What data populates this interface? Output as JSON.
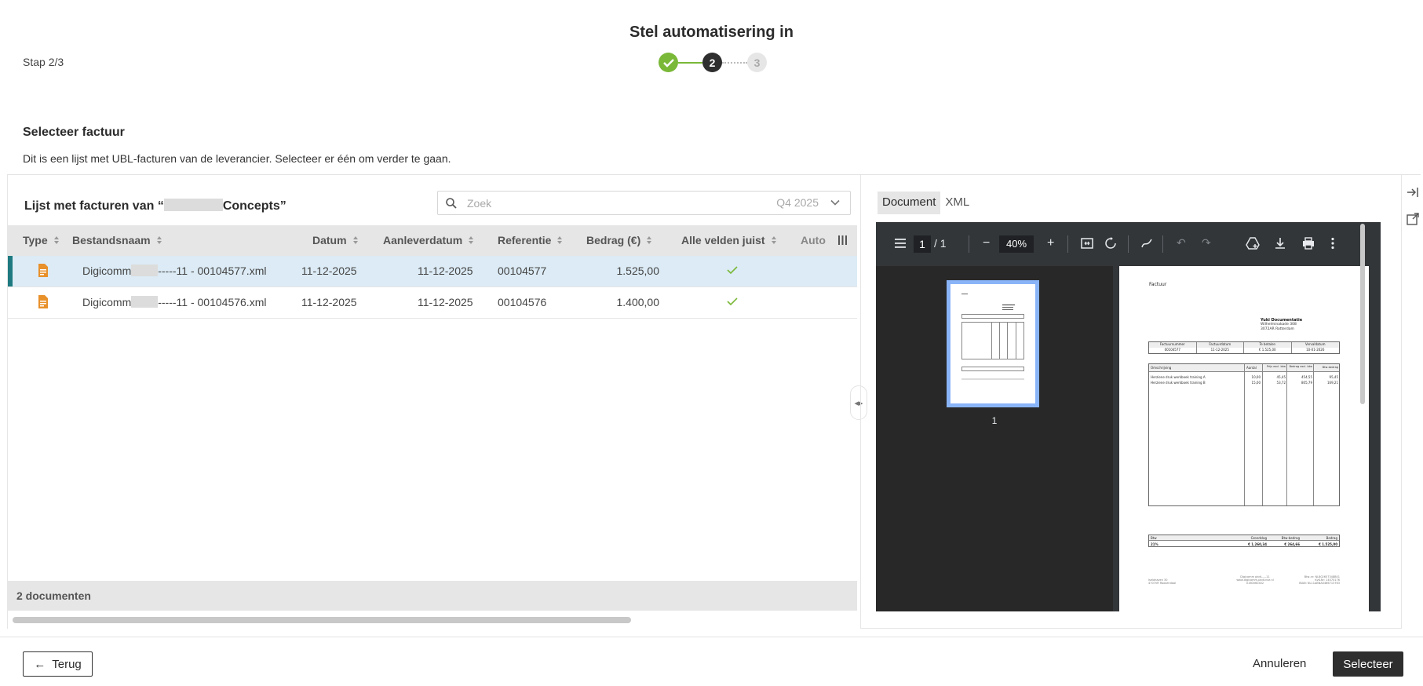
{
  "wizard": {
    "title": "Stel automatisering in",
    "step_label": "Stap 2/3",
    "steps": [
      "✓",
      "2",
      "3"
    ]
  },
  "section": {
    "title": "Selecteer factuur",
    "description": "Dit is een lijst met UBL-facturen van de leverancier. Selecteer er één om verder te gaan."
  },
  "list": {
    "title_prefix": "Lijst met facturen van “",
    "title_suffix": "Concepts”",
    "search_placeholder": "Zoek",
    "period": "Q4 2025",
    "columns": [
      "Type",
      "Bestandsnaam",
      "Datum",
      "Aanleverdatum",
      "Referentie",
      "Bedrag (€)",
      "Alle velden juist",
      "Auto"
    ],
    "rows": [
      {
        "name_prefix": "Digicomm",
        "name_suffix": "-----11 - 00104577.xml",
        "datum": "11-12-2025",
        "aanleverdatum": "11-12-2025",
        "referentie": "00104577",
        "bedrag": "1.525,00",
        "alle_velden_juist": true,
        "selected": true
      },
      {
        "name_prefix": "Digicomm",
        "name_suffix": "-----11 - 00104576.xml",
        "datum": "11-12-2025",
        "aanleverdatum": "11-12-2025",
        "referentie": "00104576",
        "bedrag": "1.400,00",
        "alle_velden_juist": true,
        "selected": false
      }
    ],
    "footer": "2 documenten"
  },
  "preview": {
    "tabs": [
      "Document",
      "XML"
    ],
    "active_tab": "Document",
    "pdf": {
      "page": "1",
      "page_total": "/  1",
      "zoom": "40%",
      "thumb_label": "1",
      "doc_heading": "Factuur",
      "company": "Yuki Documentatie",
      "address1": "Wilhelminakade 308",
      "address2": "3072AR  Rotterdam",
      "meta_headers": [
        "Factuurnummer",
        "Factuurdatum",
        "Te betalen",
        "Vervaldatum"
      ],
      "meta_values": [
        "00104577",
        "11-12-2025",
        "€ 1.525,00",
        "10-01-2026"
      ],
      "line_headers": [
        "Omschrijving",
        "Aantal",
        "Prijs excl. btw",
        "Bedrag excl. btw",
        "Btw-bedrag"
      ],
      "lines": [
        [
          "Herziene druk werkboek training A",
          "10,00",
          "45,45",
          "454,55",
          "95,45"
        ],
        [
          "Herziene druk werkboek training B",
          "15,00",
          "53,72",
          "805,79",
          "169,21"
        ]
      ],
      "tax_headers": [
        "Btw",
        "Grondslag",
        "Btw-bedrag",
        "Bedrag"
      ],
      "tax_values": [
        "21%",
        "€ 1.260,34",
        "€ 264,66",
        "€ 1.525,00"
      ],
      "footer_left1": "Iselahaven 30",
      "footer_left2": "4707VR Roosendaal",
      "footer_mid1": "Digicomm pkdt-----11",
      "footer_mid2": "www.digicomm-pkdt.nse.nl",
      "footer_mid3": "0160060402",
      "footer_right1": "Btw-nr: NL802657348B01",
      "footer_right2": "KvK-Nr: 14070176",
      "footer_right3": "IBAN: NL11ABNA0466713763"
    }
  },
  "buttons": {
    "back": "Terug",
    "cancel": "Annuleren",
    "select": "Selecteer"
  },
  "colors": {
    "accent_teal": "#1e7a80",
    "success_green": "#7ab838",
    "selected_row": "#dcebf5",
    "primary_dark": "#2e2e2e"
  }
}
